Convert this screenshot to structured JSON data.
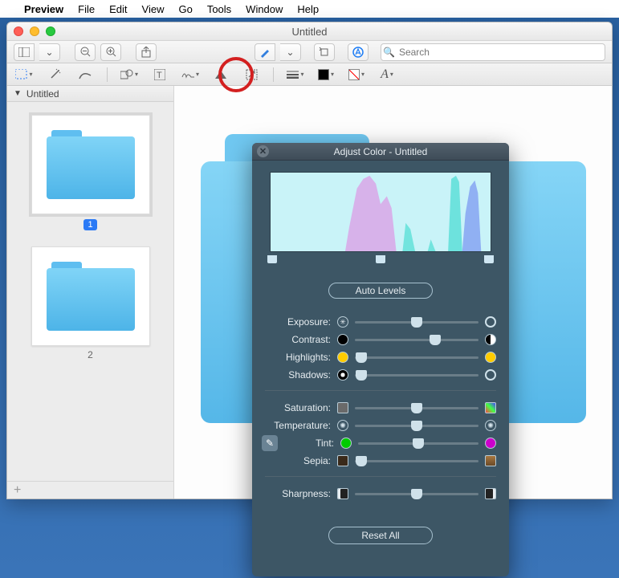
{
  "menubar": {
    "app": "Preview",
    "items": [
      "File",
      "Edit",
      "View",
      "Go",
      "Tools",
      "Window",
      "Help"
    ]
  },
  "window": {
    "title": "Untitled",
    "search_placeholder": "Search",
    "sidebar_title": "Untitled",
    "page_badge_1": "1",
    "page_label_2": "2"
  },
  "panel": {
    "title": "Adjust Color - Untitled",
    "auto_levels": "Auto Levels",
    "reset_all": "Reset All",
    "sliders": {
      "exposure": {
        "label": "Exposure:",
        "pos": 50
      },
      "contrast": {
        "label": "Contrast:",
        "pos": 65
      },
      "highlights": {
        "label": "Highlights:",
        "pos": 5
      },
      "shadows": {
        "label": "Shadows:",
        "pos": 5
      },
      "saturation": {
        "label": "Saturation:",
        "pos": 50
      },
      "temperature": {
        "label": "Temperature:",
        "pos": 50
      },
      "tint": {
        "label": "Tint:",
        "pos": 50
      },
      "sepia": {
        "label": "Sepia:",
        "pos": 5
      },
      "sharpness": {
        "label": "Sharpness:",
        "pos": 50
      }
    },
    "levels": {
      "black": 0,
      "mid": 50,
      "white": 100
    }
  }
}
